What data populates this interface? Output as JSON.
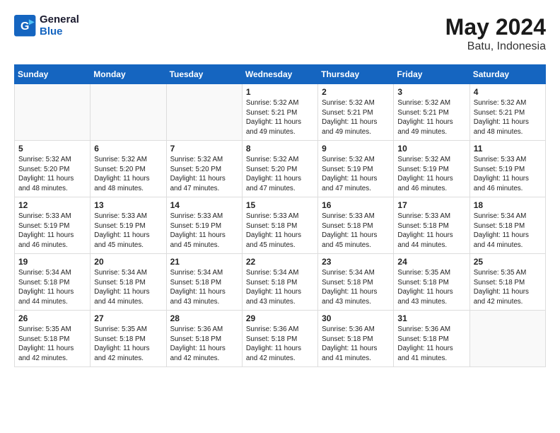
{
  "header": {
    "logo_line1": "General",
    "logo_line2": "Blue",
    "month_year": "May 2024",
    "location": "Batu, Indonesia"
  },
  "days_of_week": [
    "Sunday",
    "Monday",
    "Tuesday",
    "Wednesday",
    "Thursday",
    "Friday",
    "Saturday"
  ],
  "weeks": [
    [
      {
        "day": "",
        "info": ""
      },
      {
        "day": "",
        "info": ""
      },
      {
        "day": "",
        "info": ""
      },
      {
        "day": "1",
        "info": "Sunrise: 5:32 AM\nSunset: 5:21 PM\nDaylight: 11 hours\nand 49 minutes."
      },
      {
        "day": "2",
        "info": "Sunrise: 5:32 AM\nSunset: 5:21 PM\nDaylight: 11 hours\nand 49 minutes."
      },
      {
        "day": "3",
        "info": "Sunrise: 5:32 AM\nSunset: 5:21 PM\nDaylight: 11 hours\nand 49 minutes."
      },
      {
        "day": "4",
        "info": "Sunrise: 5:32 AM\nSunset: 5:21 PM\nDaylight: 11 hours\nand 48 minutes."
      }
    ],
    [
      {
        "day": "5",
        "info": "Sunrise: 5:32 AM\nSunset: 5:20 PM\nDaylight: 11 hours\nand 48 minutes."
      },
      {
        "day": "6",
        "info": "Sunrise: 5:32 AM\nSunset: 5:20 PM\nDaylight: 11 hours\nand 48 minutes."
      },
      {
        "day": "7",
        "info": "Sunrise: 5:32 AM\nSunset: 5:20 PM\nDaylight: 11 hours\nand 47 minutes."
      },
      {
        "day": "8",
        "info": "Sunrise: 5:32 AM\nSunset: 5:20 PM\nDaylight: 11 hours\nand 47 minutes."
      },
      {
        "day": "9",
        "info": "Sunrise: 5:32 AM\nSunset: 5:19 PM\nDaylight: 11 hours\nand 47 minutes."
      },
      {
        "day": "10",
        "info": "Sunrise: 5:32 AM\nSunset: 5:19 PM\nDaylight: 11 hours\nand 46 minutes."
      },
      {
        "day": "11",
        "info": "Sunrise: 5:33 AM\nSunset: 5:19 PM\nDaylight: 11 hours\nand 46 minutes."
      }
    ],
    [
      {
        "day": "12",
        "info": "Sunrise: 5:33 AM\nSunset: 5:19 PM\nDaylight: 11 hours\nand 46 minutes."
      },
      {
        "day": "13",
        "info": "Sunrise: 5:33 AM\nSunset: 5:19 PM\nDaylight: 11 hours\nand 45 minutes."
      },
      {
        "day": "14",
        "info": "Sunrise: 5:33 AM\nSunset: 5:19 PM\nDaylight: 11 hours\nand 45 minutes."
      },
      {
        "day": "15",
        "info": "Sunrise: 5:33 AM\nSunset: 5:18 PM\nDaylight: 11 hours\nand 45 minutes."
      },
      {
        "day": "16",
        "info": "Sunrise: 5:33 AM\nSunset: 5:18 PM\nDaylight: 11 hours\nand 45 minutes."
      },
      {
        "day": "17",
        "info": "Sunrise: 5:33 AM\nSunset: 5:18 PM\nDaylight: 11 hours\nand 44 minutes."
      },
      {
        "day": "18",
        "info": "Sunrise: 5:34 AM\nSunset: 5:18 PM\nDaylight: 11 hours\nand 44 minutes."
      }
    ],
    [
      {
        "day": "19",
        "info": "Sunrise: 5:34 AM\nSunset: 5:18 PM\nDaylight: 11 hours\nand 44 minutes."
      },
      {
        "day": "20",
        "info": "Sunrise: 5:34 AM\nSunset: 5:18 PM\nDaylight: 11 hours\nand 44 minutes."
      },
      {
        "day": "21",
        "info": "Sunrise: 5:34 AM\nSunset: 5:18 PM\nDaylight: 11 hours\nand 43 minutes."
      },
      {
        "day": "22",
        "info": "Sunrise: 5:34 AM\nSunset: 5:18 PM\nDaylight: 11 hours\nand 43 minutes."
      },
      {
        "day": "23",
        "info": "Sunrise: 5:34 AM\nSunset: 5:18 PM\nDaylight: 11 hours\nand 43 minutes."
      },
      {
        "day": "24",
        "info": "Sunrise: 5:35 AM\nSunset: 5:18 PM\nDaylight: 11 hours\nand 43 minutes."
      },
      {
        "day": "25",
        "info": "Sunrise: 5:35 AM\nSunset: 5:18 PM\nDaylight: 11 hours\nand 42 minutes."
      }
    ],
    [
      {
        "day": "26",
        "info": "Sunrise: 5:35 AM\nSunset: 5:18 PM\nDaylight: 11 hours\nand 42 minutes."
      },
      {
        "day": "27",
        "info": "Sunrise: 5:35 AM\nSunset: 5:18 PM\nDaylight: 11 hours\nand 42 minutes."
      },
      {
        "day": "28",
        "info": "Sunrise: 5:36 AM\nSunset: 5:18 PM\nDaylight: 11 hours\nand 42 minutes."
      },
      {
        "day": "29",
        "info": "Sunrise: 5:36 AM\nSunset: 5:18 PM\nDaylight: 11 hours\nand 42 minutes."
      },
      {
        "day": "30",
        "info": "Sunrise: 5:36 AM\nSunset: 5:18 PM\nDaylight: 11 hours\nand 41 minutes."
      },
      {
        "day": "31",
        "info": "Sunrise: 5:36 AM\nSunset: 5:18 PM\nDaylight: 11 hours\nand 41 minutes."
      },
      {
        "day": "",
        "info": ""
      }
    ]
  ]
}
